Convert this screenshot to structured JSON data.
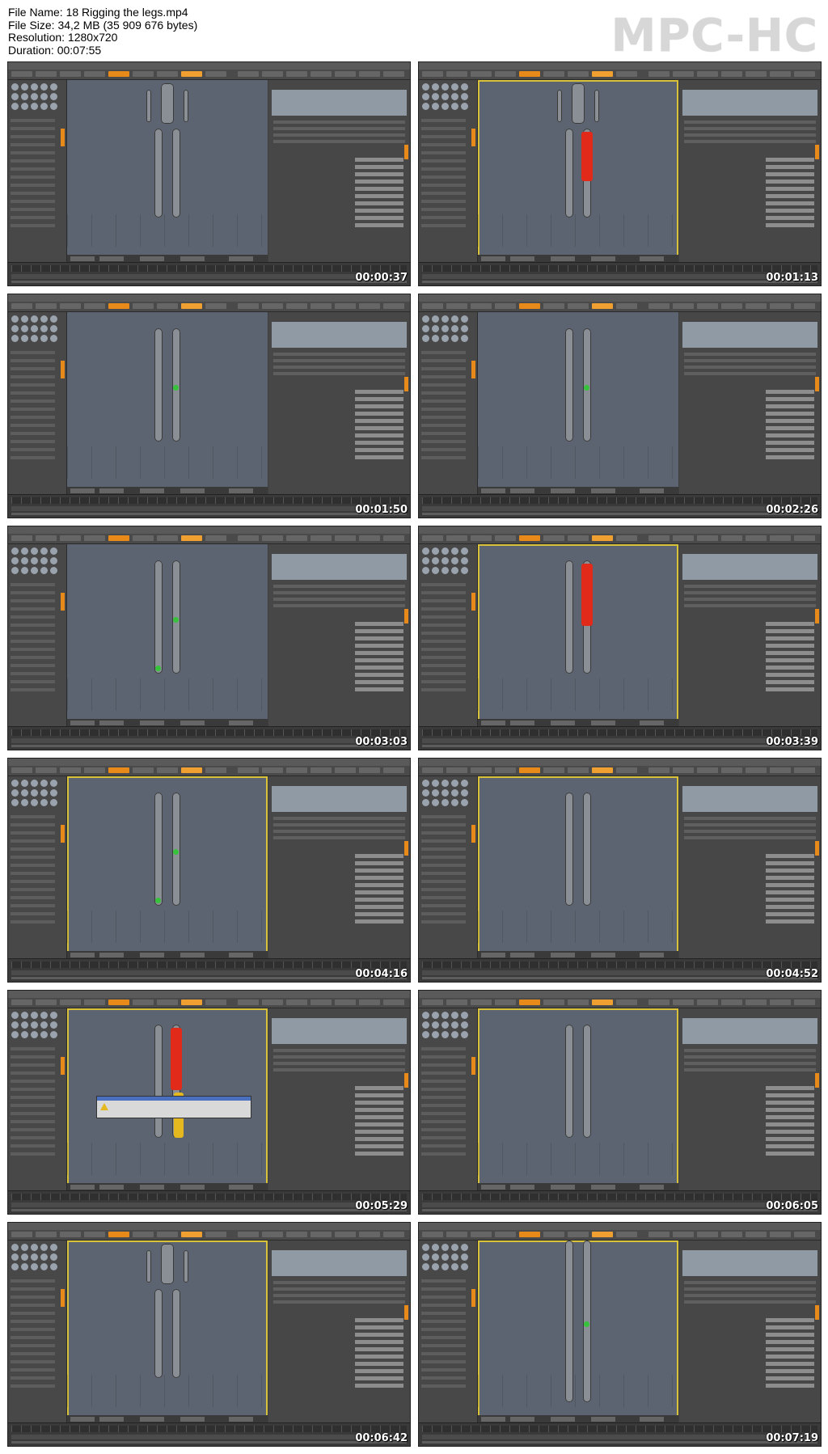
{
  "file_info": {
    "file_name": "File Name: 18 Rigging the legs.mp4",
    "file_size": "File Size: 34,2 MB (35 909 676 bytes)",
    "resolution": "Resolution: 1280x720",
    "duration": "Duration: 00:07:55"
  },
  "logo": "MPC-HC",
  "thumbnails": [
    {
      "timestamp": "00:00:37",
      "view": "full-body",
      "highlight": "none"
    },
    {
      "timestamp": "00:01:13",
      "view": "full-body",
      "highlight": "red-leg"
    },
    {
      "timestamp": "00:01:50",
      "view": "legs-side",
      "highlight": "joint"
    },
    {
      "timestamp": "00:02:26",
      "view": "legs-side",
      "highlight": "joint"
    },
    {
      "timestamp": "00:03:03",
      "view": "legs-front",
      "highlight": "joints"
    },
    {
      "timestamp": "00:03:39",
      "view": "legs-front",
      "highlight": "red-leg"
    },
    {
      "timestamp": "00:04:16",
      "view": "legs-front",
      "highlight": "joints"
    },
    {
      "timestamp": "00:04:52",
      "view": "legs-front",
      "highlight": "none"
    },
    {
      "timestamp": "00:05:29",
      "view": "legs-front",
      "highlight": "red-yellow-dialog"
    },
    {
      "timestamp": "00:06:05",
      "view": "legs-front",
      "highlight": "none"
    },
    {
      "timestamp": "00:06:42",
      "view": "full-body",
      "highlight": "none"
    },
    {
      "timestamp": "00:07:19",
      "view": "legs-closeup",
      "highlight": "joint"
    }
  ],
  "colors": {
    "accent": "#e88a1a",
    "viewport": "#5b6470",
    "bone_red": "#e12a1a",
    "bone_yellow": "#e4b81e",
    "joint_green": "#36c23a",
    "selection": "#d7c23a"
  }
}
